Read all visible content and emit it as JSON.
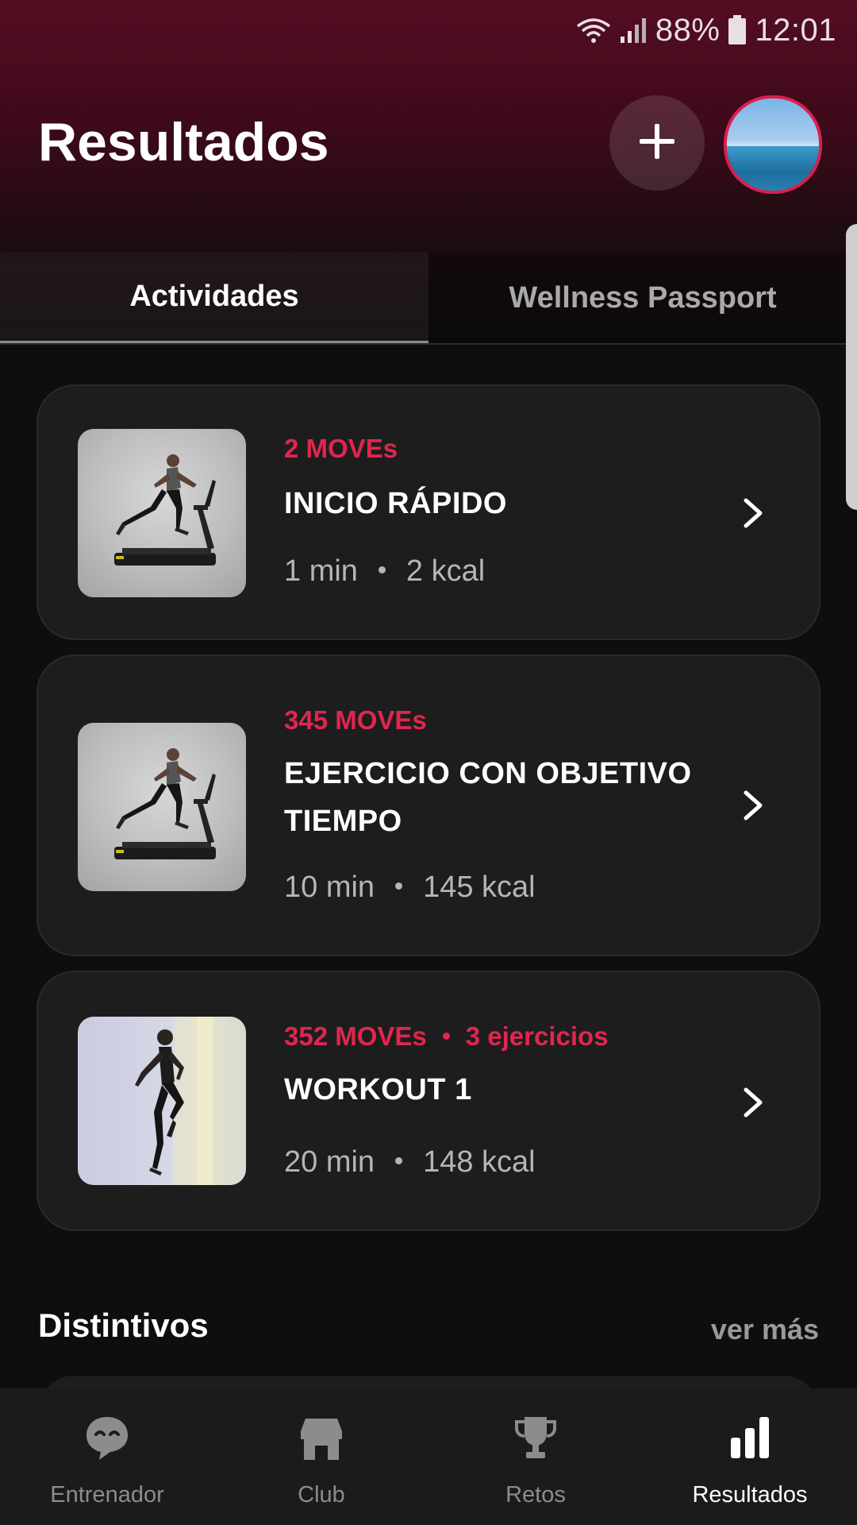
{
  "status_bar": {
    "battery": "88%",
    "time": "12:01"
  },
  "header": {
    "title": "Resultados",
    "add_icon": "plus-icon",
    "avatar": "profile-avatar"
  },
  "tabs": [
    {
      "label": "Actividades",
      "active": true
    },
    {
      "label": "Wellness Passport",
      "active": false
    }
  ],
  "activities": [
    {
      "moves": "2 MOVEs",
      "exercises": "",
      "title": "INICIO RÁPIDO",
      "duration": "1 min",
      "kcal": "2 kcal",
      "image": "treadmill-runner"
    },
    {
      "moves": "345 MOVEs",
      "exercises": "",
      "title": "EJERCICIO CON OBJETIVO TIEMPO",
      "duration": "10 min",
      "kcal": "145 kcal",
      "image": "treadmill-runner"
    },
    {
      "moves": "352 MOVEs",
      "exercises": "3 ejercicios",
      "title": "WORKOUT 1",
      "duration": "20 min",
      "kcal": "148 kcal",
      "image": "athlete-knee-raise"
    }
  ],
  "badges": {
    "title": "Distintivos",
    "see_more": "ver más"
  },
  "bottom_nav": [
    {
      "label": "Entrenador",
      "icon": "coach-chat-icon",
      "active": false
    },
    {
      "label": "Club",
      "icon": "store-icon",
      "active": false
    },
    {
      "label": "Retos",
      "icon": "trophy-icon",
      "active": false
    },
    {
      "label": "Resultados",
      "icon": "bar-chart-icon",
      "active": true
    }
  ],
  "colors": {
    "accent": "#e0264f",
    "header_gradient_top": "#550d22",
    "card_bg": "#1d1d1d",
    "page_bg": "#0e0e0e"
  }
}
